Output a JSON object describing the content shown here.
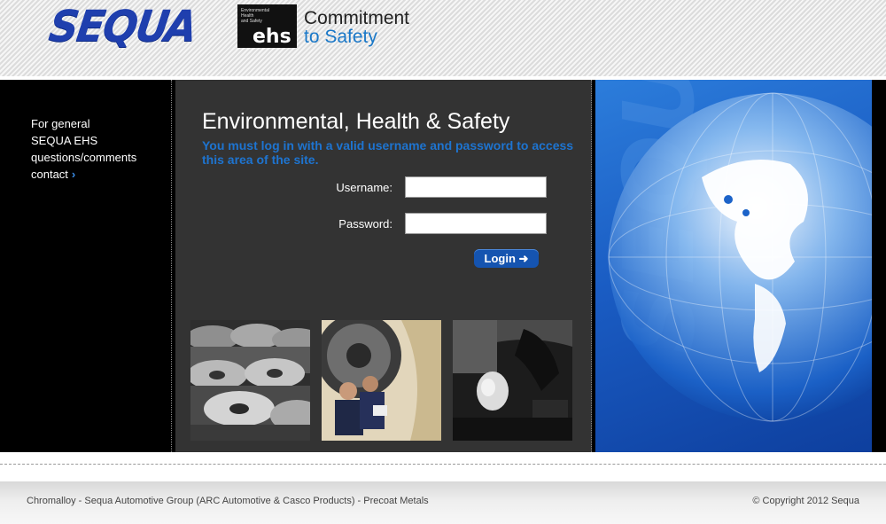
{
  "header": {
    "logo_text": "SEQUA",
    "ehs_badge": {
      "small_text_line1": "Environmental",
      "small_text_line2": "Health",
      "small_text_line3": "and Safety",
      "big_text": "ehs"
    },
    "commitment_line1": "Commitment",
    "commitment_line2": "to Safety"
  },
  "sidebar": {
    "line1": "For general",
    "line2": "SEQUA EHS",
    "line3": "questions/comments",
    "contact_label": "contact",
    "contact_arrow": "›"
  },
  "main": {
    "title": "Environmental, Health & Safety",
    "message": "You must log in with a valid username and password to access this area of the site.",
    "username_label": "Username:",
    "password_label": "Password:",
    "username_value": "",
    "password_value": "",
    "login_label": "Login ➜"
  },
  "right_panel": {
    "watermark_text": "SEQUA"
  },
  "footer": {
    "links_text": "Chromalloy - Sequa Automotive Group (ARC Automotive & Casco Products) - Precoat Metals",
    "copyright": "© Copyright 2012 Sequa"
  },
  "colors": {
    "brand_blue": "#1f3fae",
    "accent_blue": "#1e74d0",
    "login_button": "#1554b0",
    "panel_dark": "#333333"
  }
}
